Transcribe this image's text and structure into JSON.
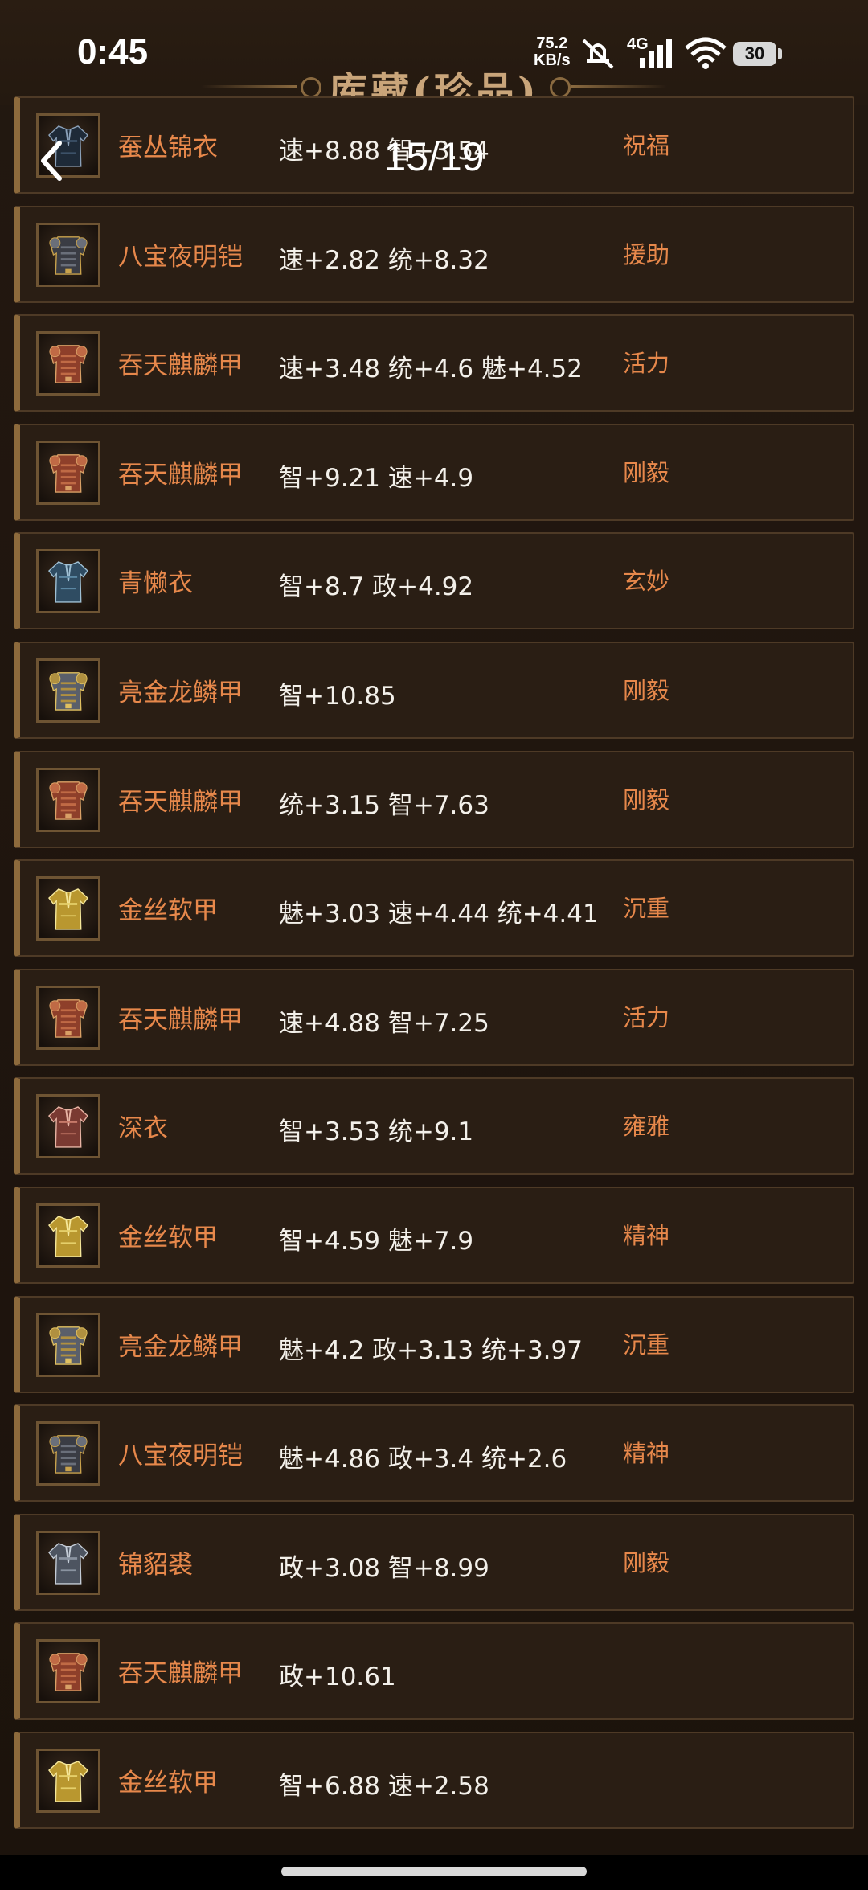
{
  "status_bar": {
    "time": "0:45",
    "speed_value": "75.2",
    "speed_unit": "KB/s",
    "network_type": "4G",
    "battery": "30",
    "icons": [
      "mute-icon",
      "signal-icon",
      "wifi-icon",
      "battery-icon"
    ]
  },
  "header": {
    "title": "库藏(珍品)",
    "page_counter": "15/19",
    "back_icon": "chevron-left-icon"
  },
  "colors": {
    "background": "#1f150e",
    "row_background": "#2a1e14",
    "name_color": "#e7884b",
    "stats_color": "#f3f0ea",
    "trait_color": "#e7884b",
    "title_color": "#c9a57a"
  },
  "items": [
    {
      "name": "蚕丛锦衣",
      "stats": "速+8.88 智+3.54",
      "trait": "祝福",
      "icon": "dark-robe-icon"
    },
    {
      "name": "八宝夜明铠",
      "stats": "速+2.82 统+8.32",
      "trait": "援助",
      "icon": "dark-armor-icon"
    },
    {
      "name": "吞天麒麟甲",
      "stats": "速+3.48 统+4.6 魅+4.52",
      "trait": "活力",
      "icon": "red-armor-icon"
    },
    {
      "name": "吞天麒麟甲",
      "stats": "智+9.21 速+4.9",
      "trait": "刚毅",
      "icon": "red-armor-icon"
    },
    {
      "name": "青懒衣",
      "stats": "智+8.7 政+4.92",
      "trait": "玄妙",
      "icon": "blue-robe-icon"
    },
    {
      "name": "亮金龙鳞甲",
      "stats": "智+10.85",
      "trait": "刚毅",
      "icon": "gold-scale-armor-icon"
    },
    {
      "name": "吞天麒麟甲",
      "stats": "统+3.15 智+7.63",
      "trait": "刚毅",
      "icon": "red-armor-icon"
    },
    {
      "name": "金丝软甲",
      "stats": "魅+3.03 速+4.44 统+4.41",
      "trait": "沉重",
      "icon": "gold-vest-icon"
    },
    {
      "name": "吞天麒麟甲",
      "stats": "速+4.88 智+7.25",
      "trait": "活力",
      "icon": "red-armor-icon"
    },
    {
      "name": "深衣",
      "stats": "智+3.53 统+9.1",
      "trait": "雍雅",
      "icon": "pink-robe-icon"
    },
    {
      "name": "金丝软甲",
      "stats": "智+4.59 魅+7.9",
      "trait": "精神",
      "icon": "gold-vest-icon"
    },
    {
      "name": "亮金龙鳞甲",
      "stats": "魅+4.2 政+3.13 统+3.97",
      "trait": "沉重",
      "icon": "gold-scale-armor-icon"
    },
    {
      "name": "八宝夜明铠",
      "stats": "魅+4.86 政+3.4 统+2.6",
      "trait": "精神",
      "icon": "dark-armor-icon"
    },
    {
      "name": "锦貂裘",
      "stats": "政+3.08 智+8.99",
      "trait": "刚毅",
      "icon": "grey-robe-icon"
    },
    {
      "name": "吞天麒麟甲",
      "stats": "政+10.61",
      "trait": "",
      "icon": "red-armor-icon"
    },
    {
      "name": "金丝软甲",
      "stats": "智+6.88 速+2.58",
      "trait": "",
      "icon": "gold-vest-icon"
    }
  ]
}
